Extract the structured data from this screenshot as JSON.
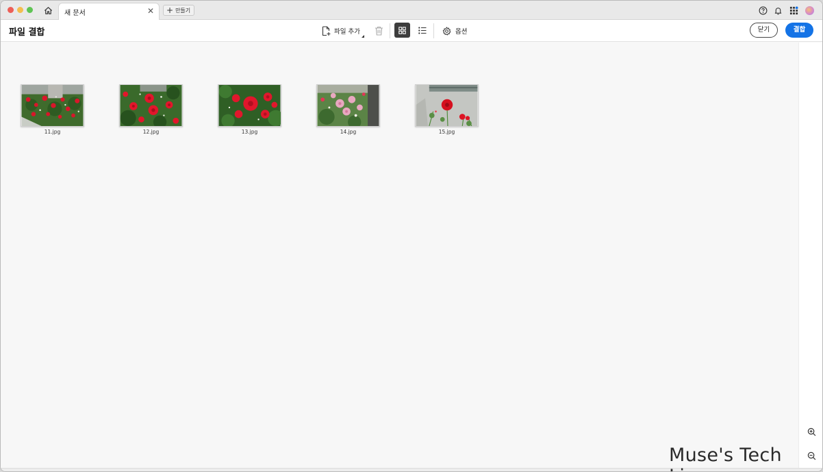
{
  "window": {
    "tab_title": "새 문서",
    "new_tab_label": "만들기",
    "close_tab_glyph": "✕",
    "new_tab_glyph": "+"
  },
  "titlebar_icons": [
    "home-icon",
    "help-icon",
    "bell-icon",
    "apps-grid-icon",
    "avatar"
  ],
  "toolbar": {
    "page_title": "파일 결합",
    "add_file_label": "파일 추가",
    "options_label": "옵션",
    "close_button_label": "닫기",
    "combine_button_label": "결합",
    "active_view": "grid",
    "accent_color": "#1473e6"
  },
  "files": [
    {
      "name": "11.jpg",
      "scene": "red-rose-bush"
    },
    {
      "name": "12.jpg",
      "scene": "red-roses-close"
    },
    {
      "name": "13.jpg",
      "scene": "red-rose-cluster"
    },
    {
      "name": "14.jpg",
      "scene": "pink-roses"
    },
    {
      "name": "15.jpg",
      "scene": "red-rose-building"
    }
  ],
  "right_rail": [
    "zoom-in-icon",
    "zoom-out-icon"
  ],
  "watermark": "Muse's Tech Live"
}
